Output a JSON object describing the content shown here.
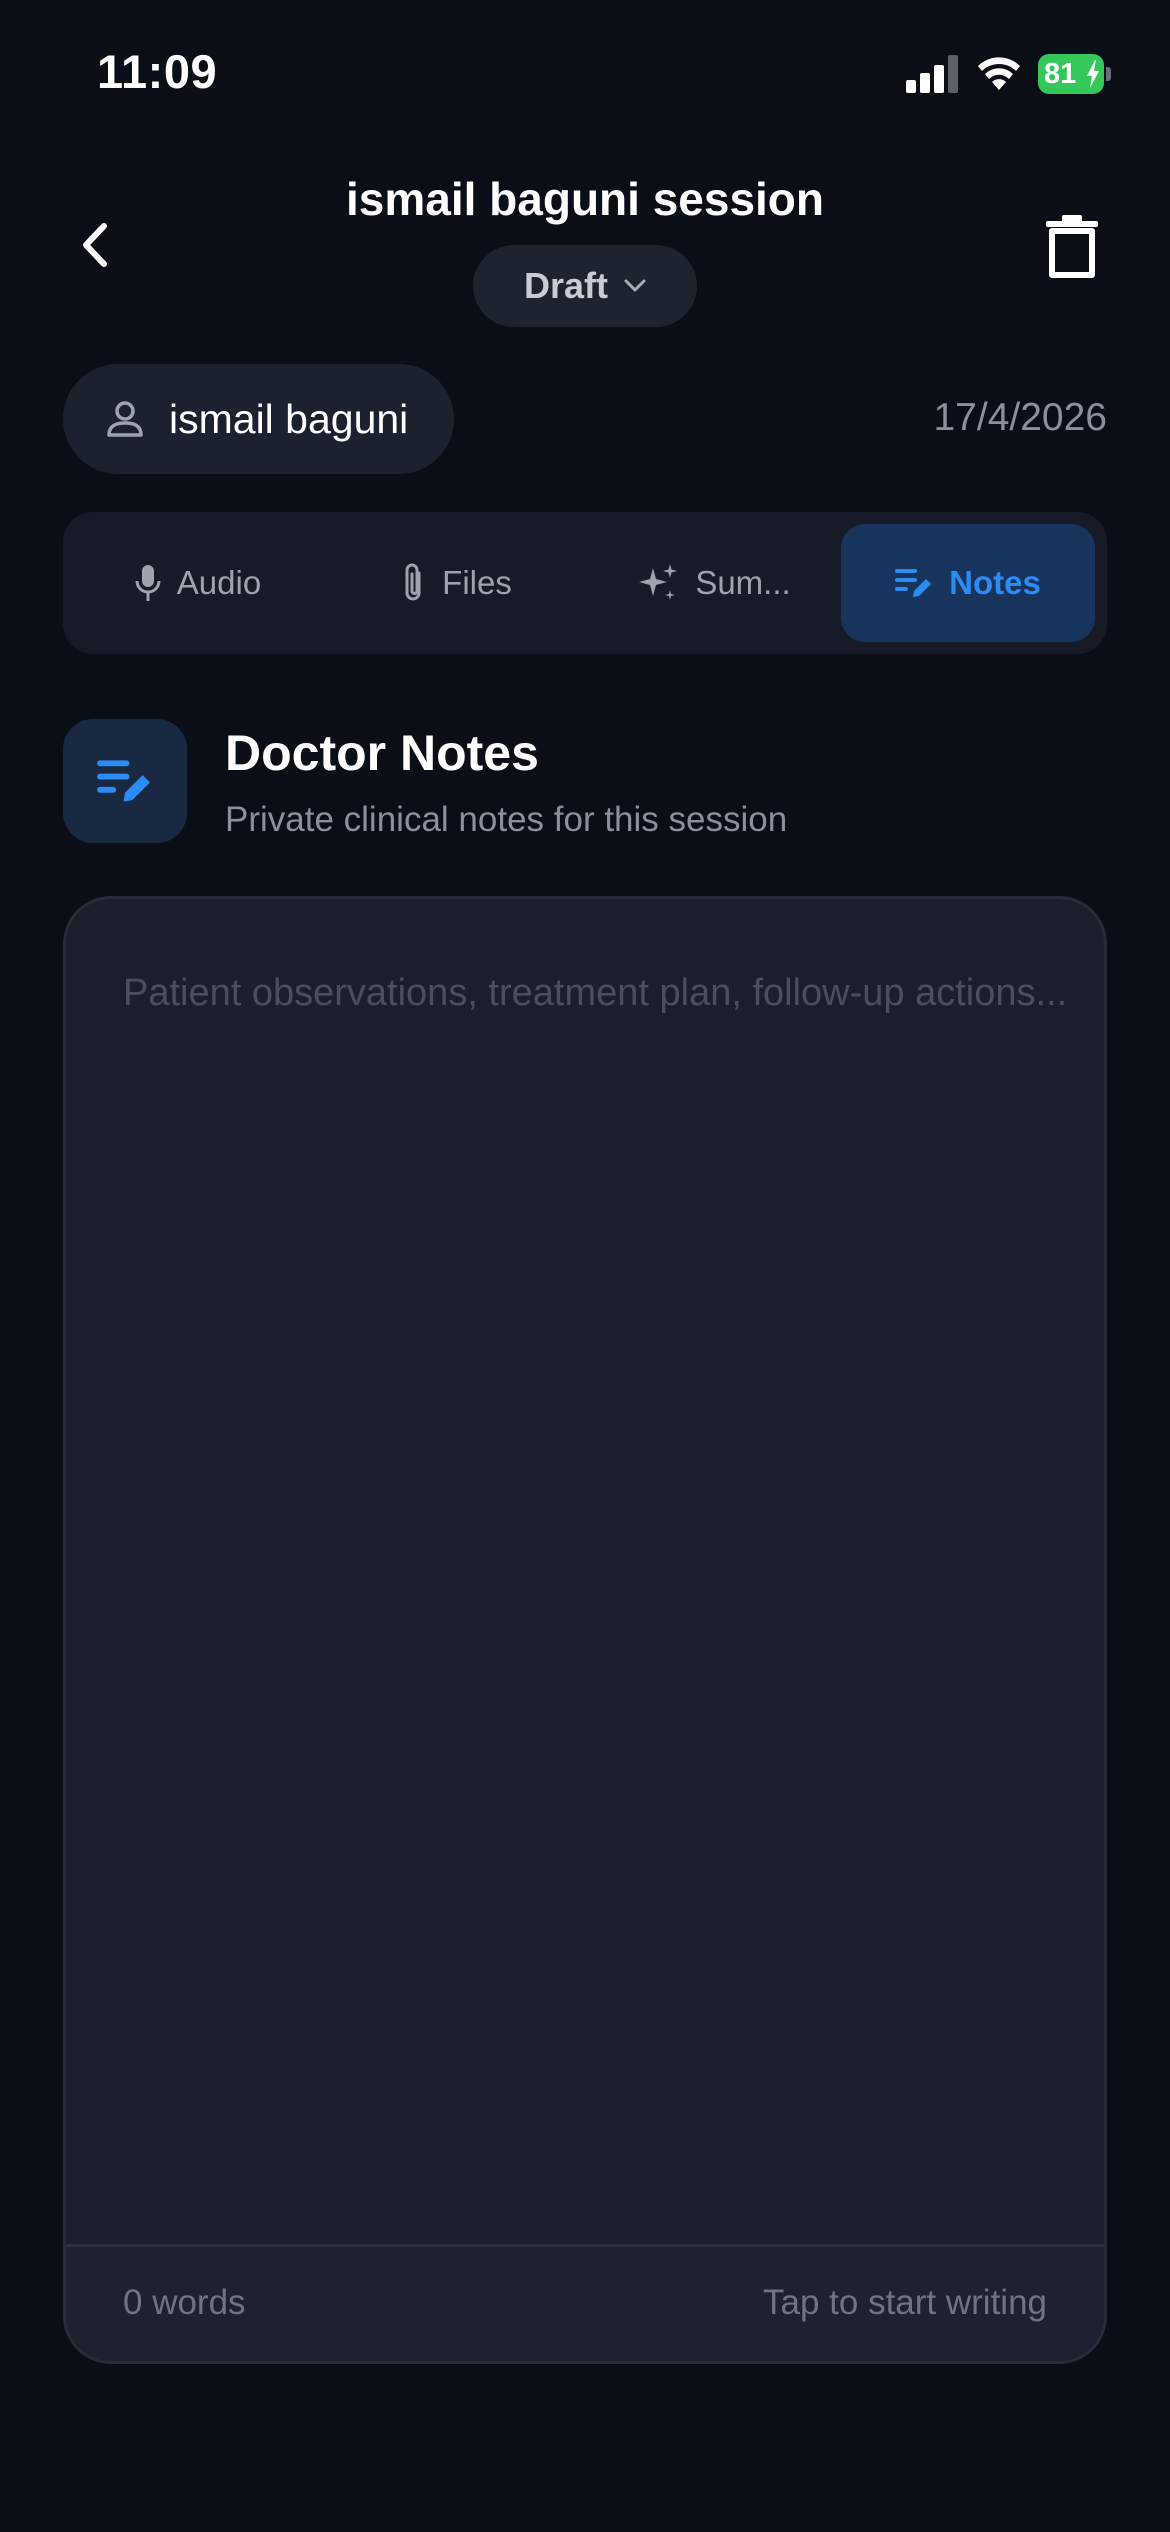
{
  "status_bar": {
    "time": "11:09",
    "battery_level": "81",
    "battery_color": "#34c759",
    "icons": [
      "signal-icon",
      "wifi-icon",
      "battery-icon",
      "charging-bolt-icon"
    ]
  },
  "header": {
    "title": "ismail baguni session",
    "status_label": "Draft",
    "back_icon": "chevron-left-icon",
    "status_icon": "chevron-down-icon",
    "delete_icon": "trash-icon"
  },
  "patient": {
    "name": "ismail baguni",
    "icon": "person-icon"
  },
  "session": {
    "date": "17/4/2026"
  },
  "tabs": [
    {
      "label": "Audio",
      "icon": "microphone-icon",
      "active": false
    },
    {
      "label": "Files",
      "icon": "paperclip-icon",
      "active": false
    },
    {
      "label": "Sum...",
      "icon": "sparkles-icon",
      "active": false
    },
    {
      "label": "Notes",
      "icon": "notes-edit-icon",
      "active": true
    }
  ],
  "notes_section": {
    "title": "Doctor Notes",
    "subtitle": "Private clinical notes for this session",
    "icon": "notes-edit-icon",
    "placeholder": "Patient observations, treatment plan, follow-up actions...",
    "value": "",
    "word_count": "0 words",
    "hint": "Tap to start writing"
  },
  "colors": {
    "background": "#0a0e17",
    "accent": "#2b8cf5",
    "active_tab_bg": "#17345c",
    "card_bg": "#1b1f2c"
  }
}
